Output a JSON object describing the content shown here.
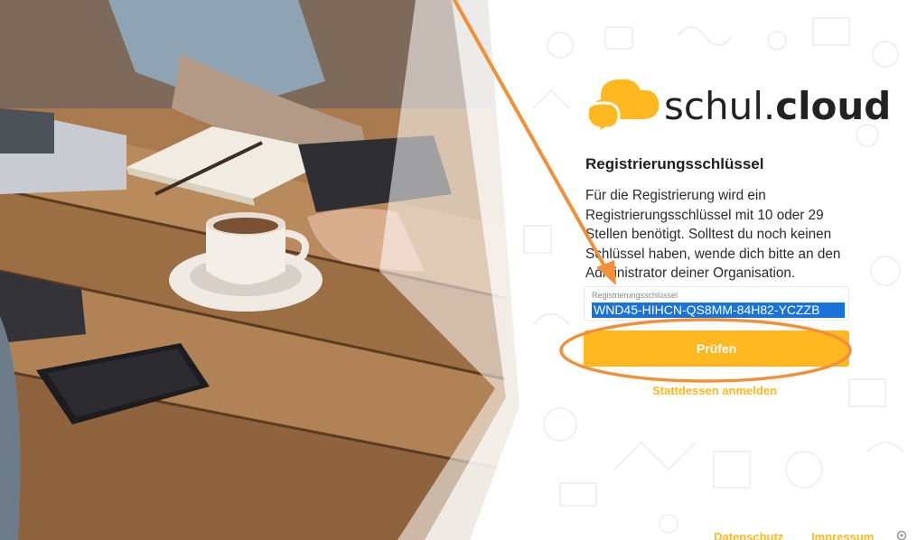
{
  "app": {
    "logo_prefix": "schul.",
    "logo_brand": "cloud"
  },
  "registration": {
    "heading": "Registrierungsschlüssel",
    "description": "Für die Registrierung wird ein Registrierungsschlüssel mit 10 oder 29 Stellen benötigt. Solltest du noch keinen Schlüssel haben, wende dich bitte an den Administrator deiner Organisation.",
    "key_label": "Registrierungsschlüssel",
    "key_value": "WND45-HIHCN-QS8MM-84H82-YCZZB",
    "check_button": "Prüfen",
    "login_link": "Stattdessen anmelden"
  },
  "footer": {
    "privacy": "Datenschutz",
    "imprint": "Impressum"
  },
  "icons": {
    "logo": "cloud-speech-icon",
    "settings": "gear-icon"
  },
  "colors": {
    "accent": "#ffb820",
    "annotation": "#f0913a",
    "selection": "#1a73d9"
  }
}
